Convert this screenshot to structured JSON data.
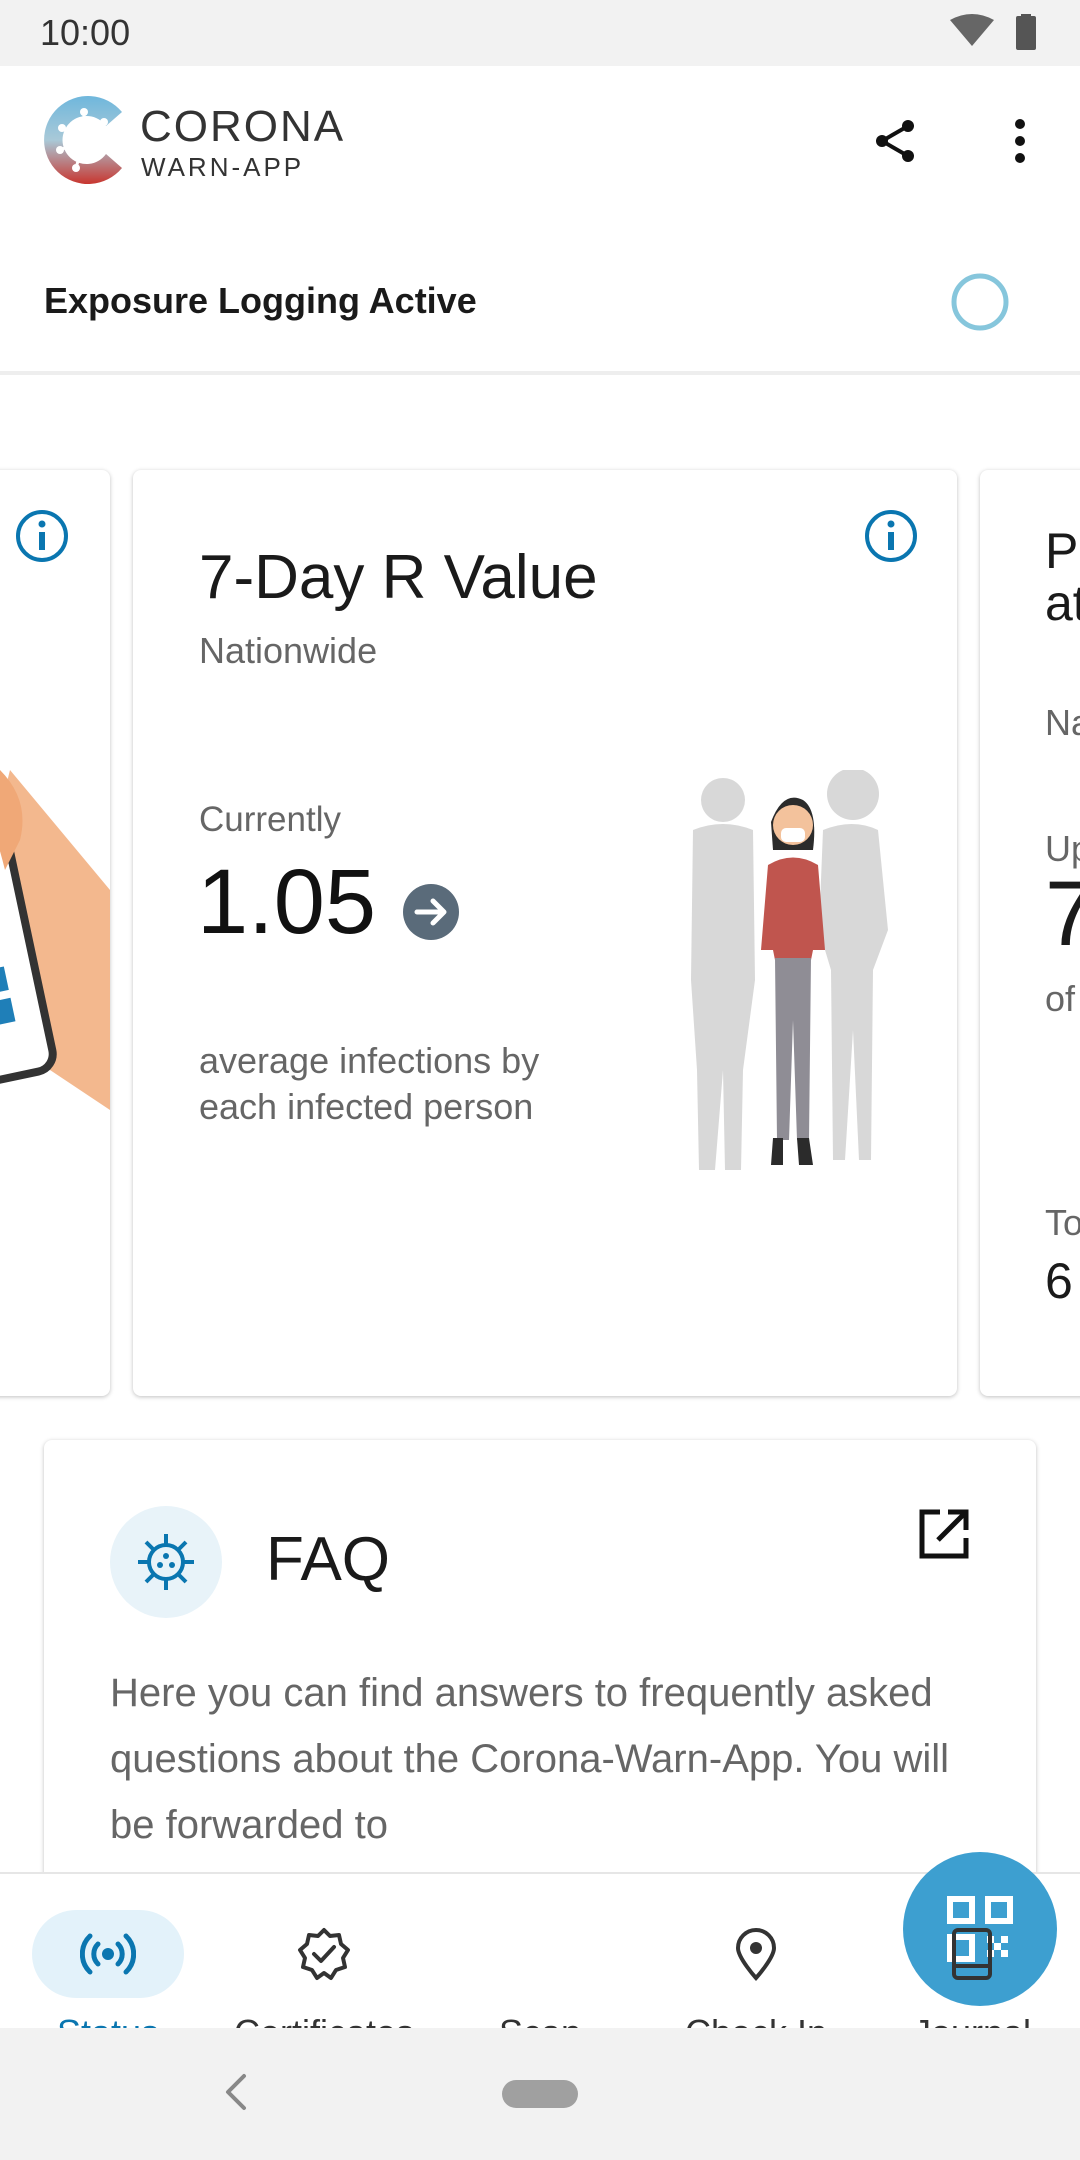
{
  "status_bar": {
    "time": "10:00"
  },
  "app": {
    "brand_name": "CORONA",
    "brand_sub": "WARN-APP",
    "exposure": {
      "label": "Exposure Logging Active"
    },
    "r_value_card": {
      "title": "7-Day R Value",
      "subtitle": "Nationwide",
      "currently_label": "Currently",
      "value": "1.05",
      "description": "average infections by each infected person"
    },
    "right_card": {
      "title_line1": "P",
      "title_line2": "at",
      "nationwide": "Na",
      "up_label": "Up",
      "value": "7",
      "of_label": "of",
      "total_label": "To",
      "total_value": "6"
    },
    "faq": {
      "title": "FAQ",
      "body": "Here you can find answers to frequently asked questions about the Corona-Warn-App. You will be forwarded to"
    }
  },
  "bottom_nav": {
    "items": [
      {
        "label": "Status",
        "active": true
      },
      {
        "label": "Certificates",
        "active": false
      },
      {
        "label": "Scan",
        "active": false
      },
      {
        "label": "Check In",
        "active": false
      },
      {
        "label": "Journal",
        "active": false
      }
    ]
  },
  "colors": {
    "accent": "#0a76b0",
    "fab": "#3d9fd0",
    "status_pill": "#e3f2fa",
    "ring": "#86c6dc"
  }
}
